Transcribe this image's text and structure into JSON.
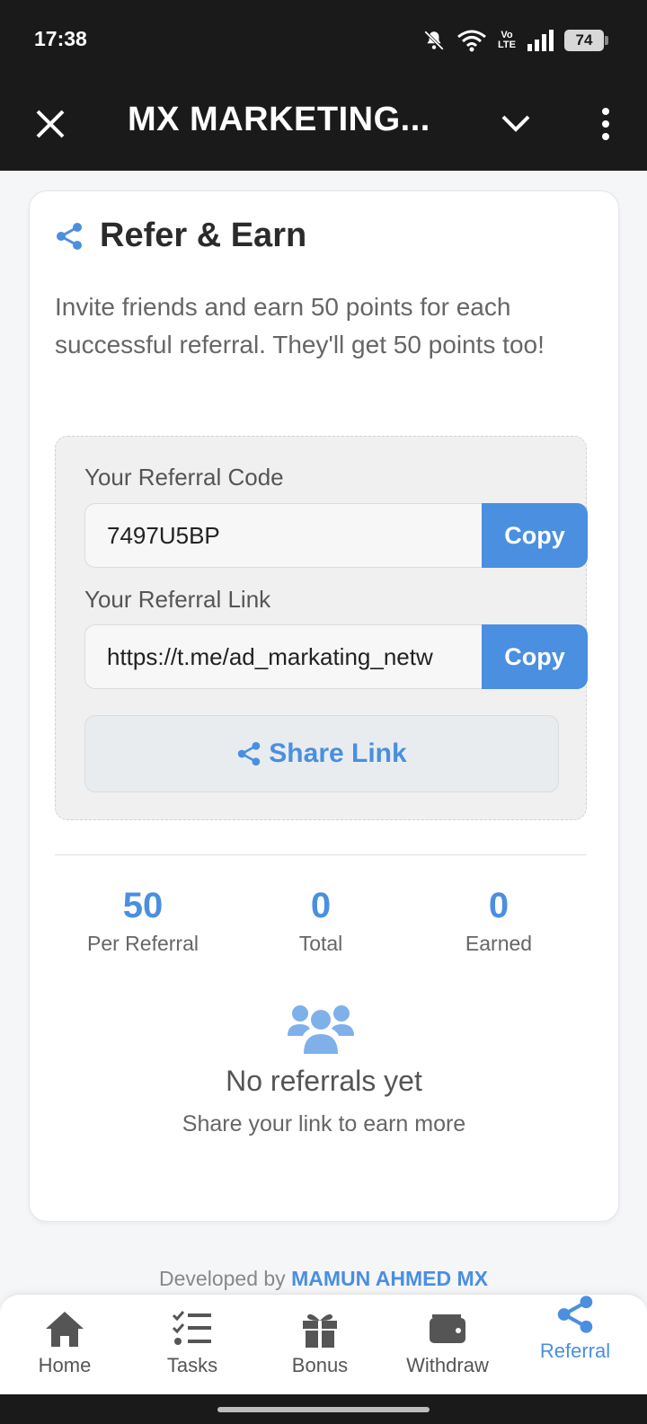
{
  "status_bar": {
    "time": "17:38",
    "volte": "Vo\nLTE",
    "battery": "74"
  },
  "app_bar": {
    "title": "MX MARKETING..."
  },
  "referral": {
    "title": "Refer & Earn",
    "description": "Invite friends and earn 50 points for each successful referral. They'll get 50 points too!",
    "code_label": "Your Referral Code",
    "code_value": "7497U5BP",
    "link_label": "Your Referral Link",
    "link_value": "https://t.me/ad_markating_netw",
    "copy_label": "Copy",
    "share_label": "Share Link"
  },
  "stats": [
    {
      "value": "50",
      "label": "Per Referral"
    },
    {
      "value": "0",
      "label": "Total"
    },
    {
      "value": "0",
      "label": "Earned"
    }
  ],
  "empty_state": {
    "icon": "users-icon",
    "title": "No referrals yet",
    "subtitle": "Share your link to earn more"
  },
  "footer": {
    "prefix": "Developed by",
    "developer": "MAMUN AHMED MX"
  },
  "bottom_nav": [
    {
      "label": "Home",
      "icon": "home-icon"
    },
    {
      "label": "Tasks",
      "icon": "tasks-icon"
    },
    {
      "label": "Bonus",
      "icon": "gift-icon"
    },
    {
      "label": "Withdraw",
      "icon": "wallet-icon"
    },
    {
      "label": "Referral",
      "icon": "share-icon",
      "active": true
    }
  ],
  "colors": {
    "accent": "#4a8fe0",
    "bar_dark": "#1a1a1a",
    "text_muted": "#666666"
  }
}
